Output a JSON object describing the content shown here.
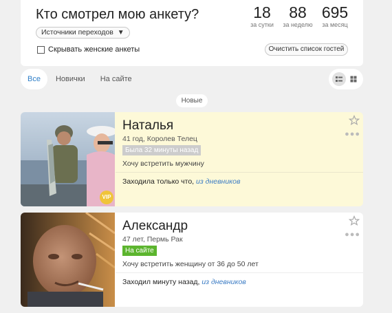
{
  "header": {
    "title": "Кто смотрел мою анкету?",
    "sources_label": "Источники переходов",
    "sources_arrow": "▼",
    "hide_female_label": "Скрывать женские анкеты",
    "clear_label": "Очистить список гостей",
    "stats": [
      {
        "value": "18",
        "label": "за сутки"
      },
      {
        "value": "88",
        "label": "за неделю"
      },
      {
        "value": "695",
        "label": "за месяц"
      }
    ]
  },
  "tabs": [
    "Все",
    "Новички",
    "На сайте"
  ],
  "section_label": "Новые",
  "profiles": [
    {
      "name": "Наталья",
      "info": "41 год, Королев Телец",
      "status": "Была 32 минуты назад",
      "wish": "Хочу встретить мужчину",
      "visit_text": "Заходила только что,",
      "visit_source": "из дневников",
      "badge": "VIP"
    },
    {
      "name": "Александр",
      "info": "47 лет, Пермь Рак",
      "status": "На сайте",
      "wish": "Хочу встретить женщину от 36 до 50 лет",
      "visit_text": "Заходил минуту назад,",
      "visit_source": "из дневников"
    }
  ],
  "colors": {
    "accent": "#2f7fc8",
    "online": "#5cb52e",
    "vip": "#f0c43a",
    "card_highlight": "#fdf9d8"
  },
  "icons": [
    "star-icon",
    "more-dots-icon",
    "list-view-icon",
    "grid-view-icon",
    "dropdown-arrow-icon"
  ]
}
